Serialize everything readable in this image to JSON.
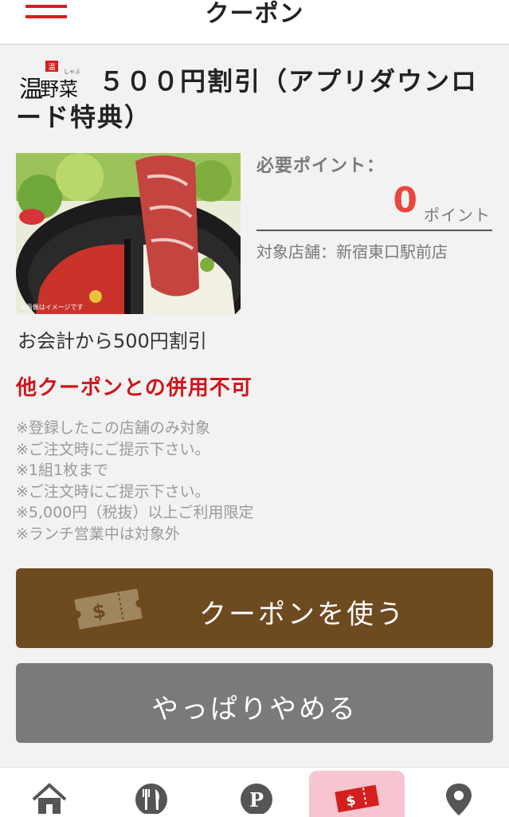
{
  "header": {
    "title": "クーポン"
  },
  "coupon": {
    "title": "５００円割引（アプリダウンロード特典）",
    "photo_note": "※画像はイメージです",
    "points_label": "必要ポイント：",
    "points_value": "0",
    "points_unit": "ポイント",
    "store": "対象店舗：新宿東口駅前店",
    "discount": "お会計から500円割引",
    "warning": "他クーポンとの併用不可",
    "notes": [
      "※登録したこの店舗のみ対象",
      "※ご注文時にご提示下さい。",
      "※1組1枚まで",
      "※ご注文時にご提示下さい。",
      "※5,000円（税抜）以上ご利用限定",
      "※ランチ営業中は対象外"
    ]
  },
  "buttons": {
    "use_label": "クーポンを使う",
    "cancel_label": "やっぱりやめる"
  },
  "tabbar": {
    "items": [
      {
        "icon": "home-icon"
      },
      {
        "icon": "fork-knife-icon"
      },
      {
        "icon": "points-icon"
      },
      {
        "icon": "coupon-icon",
        "active": true
      },
      {
        "icon": "map-pin-icon"
      }
    ]
  },
  "colors": {
    "accent": "#d51f1f",
    "brown": "#6e4a20",
    "gray_button": "#7a7a7a",
    "warning": "#d0141b",
    "points": "#e8473d",
    "active_tab": "#f6c5cf"
  }
}
